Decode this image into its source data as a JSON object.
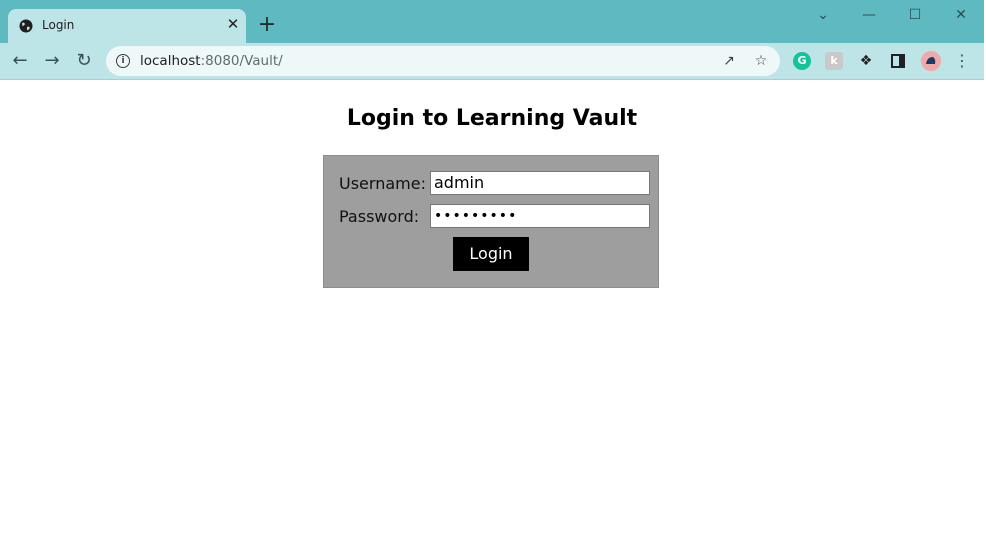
{
  "browser": {
    "tab": {
      "title": "Login",
      "close": "✕"
    },
    "new_tab": "+",
    "window_controls": {
      "dropdown": "⌄",
      "minimize": "—",
      "maximize": "☐",
      "close": "✕"
    },
    "address": {
      "host": "localhost",
      "path": ":8080/Vault/"
    },
    "icons": [
      "back-icon",
      "forward-icon",
      "reload-icon",
      "info-icon",
      "share-icon",
      "bookmark-star-icon",
      "grammarly-icon",
      "extension-k-icon",
      "extensions-puzzle-icon",
      "side-panel-icon",
      "profile-avatar",
      "menu-icon"
    ]
  },
  "page": {
    "heading": "Login to Learning Vault",
    "form": {
      "username_label": "Username:",
      "username_value": "admin",
      "password_label": "Password:",
      "password_value": "•••••••••",
      "submit_label": "Login"
    }
  },
  "colors": {
    "tabstrip": "#5fb9c1",
    "toolbar": "#bde4e7",
    "form_bg": "#9e9e9e",
    "button_bg": "#000000"
  }
}
